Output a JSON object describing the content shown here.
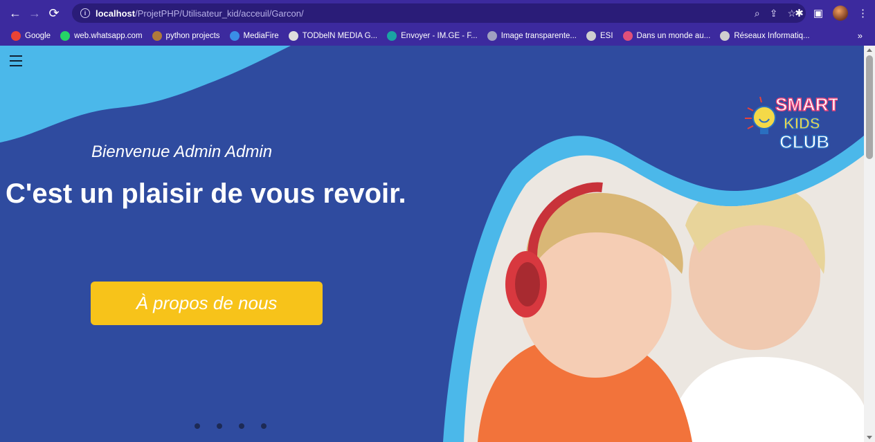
{
  "browser": {
    "url_host": "localhost",
    "url_path": "/ProjetPHP/Utilisateur_kid/acceuil/Garcon/",
    "bookmarks": [
      {
        "label": "Google",
        "color": "#ea4335"
      },
      {
        "label": "web.whatsapp.com",
        "color": "#25d366"
      },
      {
        "label": "python projects",
        "color": "#b07a3a"
      },
      {
        "label": "MediaFire",
        "color": "#3a8ee6"
      },
      {
        "label": "TODbelN MEDIA G...",
        "color": "#dddddd"
      },
      {
        "label": "Envoyer - IM.GE - F...",
        "color": "#1aa3a3"
      },
      {
        "label": "Image transparente...",
        "color": "#a0a0c0"
      },
      {
        "label": "ESI",
        "color": "#cfcfcf"
      },
      {
        "label": "Dans un monde au...",
        "color": "#e0507a"
      },
      {
        "label": "Réseaux Informatiq...",
        "color": "#cfcfcf"
      }
    ],
    "more_label": "»"
  },
  "hero": {
    "welcome": "Bienvenue Admin Admin",
    "headline": "C'est un plaisir de vous revoir.",
    "about_button": "À propos de nous",
    "slides": 4
  },
  "logo": {
    "line1": "SMART",
    "line2": "KIDS",
    "line3": "CLUB"
  },
  "colors": {
    "page_bg": "#2f4b9f",
    "wave": "#4bb8ea",
    "button": "#f7c31a",
    "chrome": "#3c2a9e"
  }
}
